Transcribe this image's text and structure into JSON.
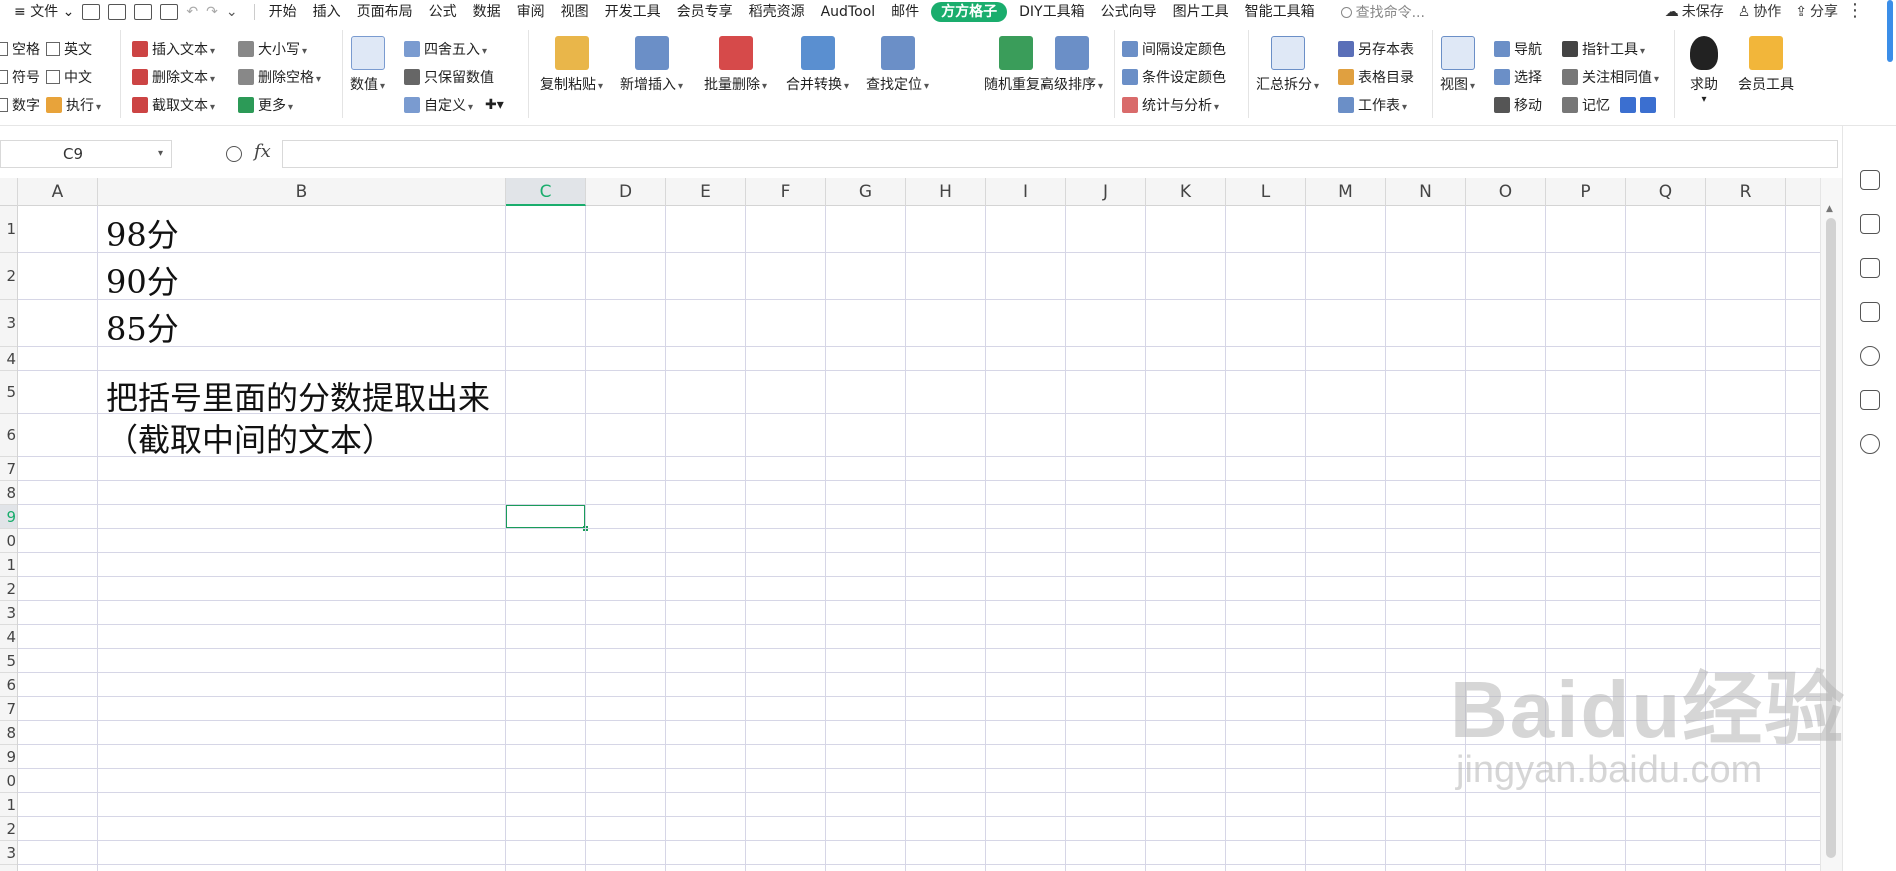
{
  "menubar": {
    "file_label": "文件",
    "tabs": [
      "开始",
      "插入",
      "页面布局",
      "公式",
      "数据",
      "审阅",
      "视图",
      "开发工具",
      "会员专享",
      "稻壳资源",
      "AudTool",
      "邮件",
      "方方格子",
      "DIY工具箱",
      "公式向导",
      "图片工具",
      "智能工具箱"
    ],
    "active_tab": "方方格子",
    "search_placeholder": "查找命令...",
    "unsaved": "未保存",
    "collab": "协作",
    "share": "分享"
  },
  "ribbon": {
    "checks": [
      "空格",
      "符号",
      "数字",
      "英文",
      "中文"
    ],
    "execute": "执行",
    "text_ops": [
      "插入文本",
      "删除文本",
      "截取文本"
    ],
    "case_ops": [
      "大小写",
      "删除空格",
      "更多"
    ],
    "numeric": "数值",
    "round_ops": [
      "四舍五入",
      "只保留数值",
      "自定义"
    ],
    "big_buttons": [
      "复制粘贴",
      "新增插入",
      "批量删除",
      "合并转换",
      "查找定位",
      "随机重复",
      "高级排序"
    ],
    "color_ops": [
      "间隔设定颜色",
      "条件设定颜色",
      "统计与分析"
    ],
    "summary_split": "汇总拆分",
    "sheet_ops": [
      "另存本表",
      "表格目录",
      "工作表"
    ],
    "view": "视图",
    "nav_ops": [
      "导航",
      "选择",
      "移动"
    ],
    "pointer_ops": [
      "指针工具",
      "关注相同值",
      "记忆"
    ],
    "help": "求助",
    "member_tools": "会员工具"
  },
  "formula_bar": {
    "cell_ref": "C9",
    "fx_label": "fx",
    "formula": ""
  },
  "sheet": {
    "columns": [
      "A",
      "B",
      "C",
      "D",
      "E",
      "F",
      "G",
      "H",
      "I",
      "J",
      "K",
      "L",
      "M",
      "N",
      "O",
      "P",
      "Q",
      "R"
    ],
    "selected_column": "C",
    "row_labels": [
      "1",
      "2",
      "3",
      "4",
      "5",
      "6",
      "7",
      "8",
      "9",
      "0",
      "1",
      "2",
      "3",
      "4",
      "5",
      "6",
      "7",
      "8",
      "9",
      "0",
      "1",
      "2",
      "3"
    ],
    "selected_row_index": 8,
    "cell_B1": "98分",
    "cell_B2": "90分",
    "cell_B3": "85分",
    "cell_B5_line1": "把括号里面的分数提取出来",
    "cell_B5_line2": "（截取中间的文本）"
  },
  "watermark": {
    "main": "Baidu经验",
    "sub": "jingyan.baidu.com"
  }
}
